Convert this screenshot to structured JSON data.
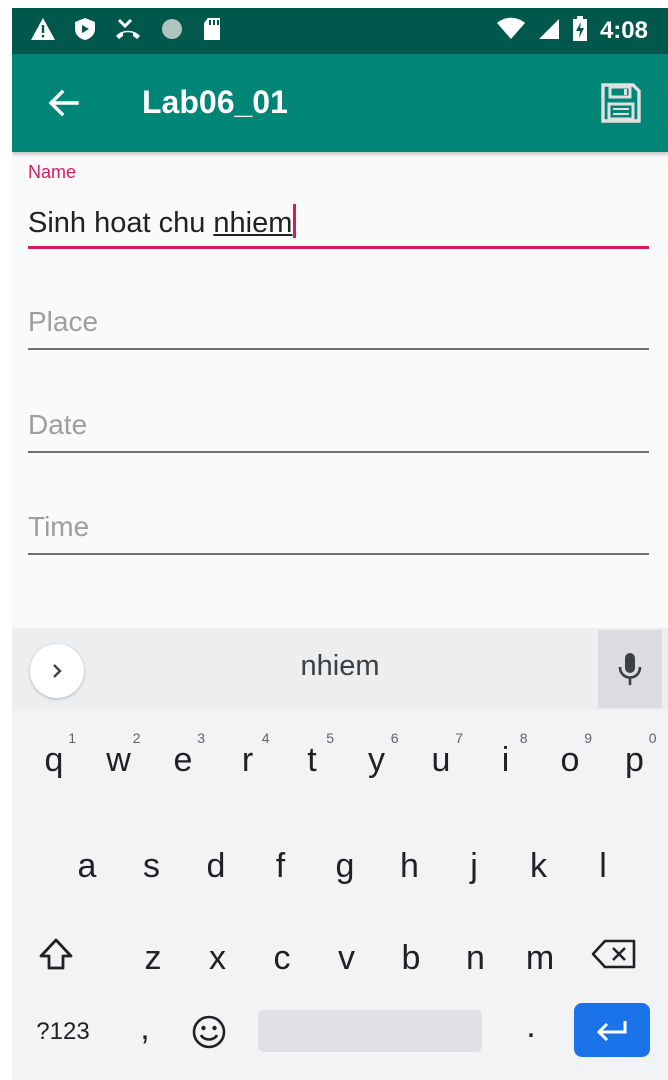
{
  "status_bar": {
    "left_icons": [
      "warning-icon",
      "shield-icon",
      "missed-call-icon",
      "circle-icon",
      "sd-card-icon"
    ],
    "right_icons": [
      "wifi-icon",
      "signal-icon",
      "battery-charging-icon"
    ],
    "time": "4:08"
  },
  "app_bar": {
    "back_icon": "arrow-back-icon",
    "title": "Lab06_01",
    "save_icon": "save-icon"
  },
  "form": {
    "name": {
      "label": "Name",
      "value_prefix": "Sinh hoat chu ",
      "value_composing": "nhiem"
    },
    "place": {
      "placeholder": "Place",
      "value": ""
    },
    "date": {
      "placeholder": "Date",
      "value": ""
    },
    "time": {
      "placeholder": "Time",
      "value": ""
    }
  },
  "keyboard": {
    "suggestion": "nhiem",
    "rows": [
      [
        {
          "k": "q",
          "h": "1"
        },
        {
          "k": "w",
          "h": "2"
        },
        {
          "k": "e",
          "h": "3"
        },
        {
          "k": "r",
          "h": "4"
        },
        {
          "k": "t",
          "h": "5"
        },
        {
          "k": "y",
          "h": "6"
        },
        {
          "k": "u",
          "h": "7"
        },
        {
          "k": "i",
          "h": "8"
        },
        {
          "k": "o",
          "h": "9"
        },
        {
          "k": "p",
          "h": "0"
        }
      ],
      [
        {
          "k": "a"
        },
        {
          "k": "s"
        },
        {
          "k": "d"
        },
        {
          "k": "f"
        },
        {
          "k": "g"
        },
        {
          "k": "h"
        },
        {
          "k": "j"
        },
        {
          "k": "k"
        },
        {
          "k": "l"
        }
      ],
      [
        {
          "k": "z"
        },
        {
          "k": "x"
        },
        {
          "k": "c"
        },
        {
          "k": "v"
        },
        {
          "k": "b"
        },
        {
          "k": "n"
        },
        {
          "k": "m"
        }
      ]
    ],
    "symbols_label": "?123",
    "comma_label": ",",
    "period_label": ".",
    "accent_color": "#1a73e8",
    "field_accent_color": "#d81b60",
    "toolbar_color": "#008577"
  }
}
